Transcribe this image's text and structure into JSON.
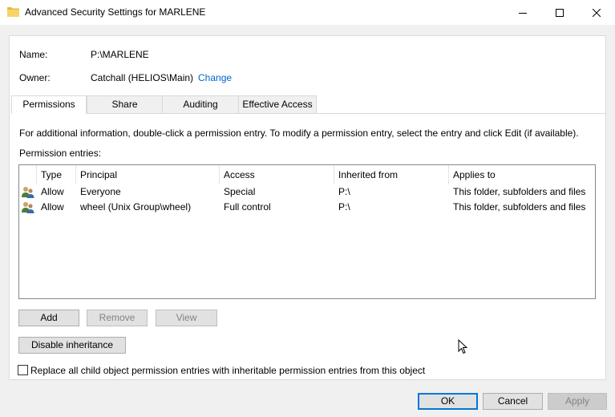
{
  "window": {
    "title": "Advanced Security Settings for MARLENE"
  },
  "info": {
    "name_label": "Name:",
    "name_value": "P:\\MARLENE",
    "owner_label": "Owner:",
    "owner_value": "Catchall (HELIOS\\Main)",
    "change_link": "Change"
  },
  "tabs": [
    {
      "label": "Permissions",
      "active": true
    },
    {
      "label": "Share",
      "active": false
    },
    {
      "label": "Auditing",
      "active": false
    },
    {
      "label": "Effective Access",
      "active": false
    }
  ],
  "permissions": {
    "info_text": "For additional information, double-click a permission entry. To modify a permission entry, select the entry and click Edit (if available).",
    "entries_label": "Permission entries:",
    "columns": [
      "Type",
      "Principal",
      "Access",
      "Inherited from",
      "Applies to"
    ],
    "rows": [
      {
        "icon": "group-users-icon",
        "type": "Allow",
        "principal": "Everyone",
        "access": "Special",
        "inherited_from": "P:\\",
        "applies_to": "This folder, subfolders and files"
      },
      {
        "icon": "group-users-icon",
        "type": "Allow",
        "principal": "wheel (Unix Group\\wheel)",
        "access": "Full control",
        "inherited_from": "P:\\",
        "applies_to": "This folder, subfolders and files"
      }
    ],
    "add_button": "Add",
    "remove_button": "Remove",
    "view_button": "View",
    "disable_inheritance_button": "Disable inheritance",
    "replace_checkbox_label": "Replace all child object permission entries with inheritable permission entries from this object",
    "replace_checked": false
  },
  "footer": {
    "ok_button": "OK",
    "cancel_button": "Cancel",
    "apply_button": "Apply"
  },
  "colors": {
    "link": "#0066cc",
    "accent": "#0078d7",
    "disabled_text": "#838383"
  }
}
